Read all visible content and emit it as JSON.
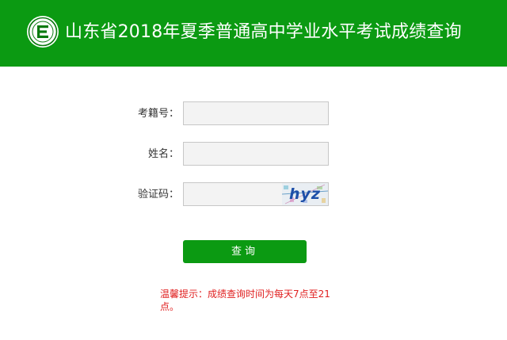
{
  "header": {
    "title": "山东省2018年夏季普通高中学业水平考试成绩查询",
    "logo_icon": "education-seal-icon",
    "background_color": "#0b9a12"
  },
  "form": {
    "exam_number_label": "考籍号：",
    "exam_number_value": "",
    "name_label": "姓名：",
    "name_value": "",
    "captcha_label": "验证码：",
    "captcha_value": "",
    "captcha_image_text": "hyz"
  },
  "actions": {
    "query_label": "查询",
    "button_color": "#0b9a12"
  },
  "notice": {
    "text": "温馨提示：成绩查询时间为每天7点至21点。",
    "color": "#e02020"
  }
}
